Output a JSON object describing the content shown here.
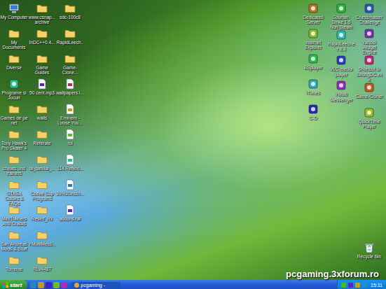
{
  "desktop": {
    "left_columns": [
      [
        {
          "label": "My Computer",
          "kind": "computer"
        },
        {
          "label": "My Documents",
          "kind": "folder"
        },
        {
          "label": "Diverse",
          "kind": "folder"
        },
        {
          "label": "Programe si Jocuri",
          "kind": "app"
        },
        {
          "label": "Games de pe net",
          "kind": "folder"
        },
        {
          "label": "Tony Hawk's Pro Skater 4",
          "kind": "folder"
        },
        {
          "label": "cheats und trainers",
          "kind": "folder"
        },
        {
          "label": "GTASA Guides & FAQs",
          "kind": "folder"
        },
        {
          "label": "MiniTrainers And Cracks",
          "kind": "folder"
        },
        {
          "label": "San Andreas Mods & Stuff",
          "kind": "folder"
        },
        {
          "label": "Torrente",
          "kind": "folder"
        }
      ],
      [
        {
          "label": "www.csnap... archive",
          "kind": "folder"
        },
        {
          "label": "InDC++0.4...",
          "kind": "folder"
        },
        {
          "label": "Game Guides",
          "kind": "folder"
        },
        {
          "label": "50 cent.mp3",
          "kind": "file"
        },
        {
          "label": "walls",
          "kind": "folder"
        },
        {
          "label": "Referate",
          "kind": "folder"
        },
        {
          "label": "la_familia_...",
          "kind": "folder"
        },
        {
          "label": "Coffee Cup Programs",
          "kind": "folder"
        },
        {
          "label": "Resetf_Rx",
          "kind": "folder"
        },
        {
          "label": "YMultiMess...",
          "kind": "folder"
        },
        {
          "label": "RLv4487",
          "kind": "folder"
        }
      ],
      [
        {
          "label": "sdc-100c8",
          "kind": "folder"
        },
        {
          "label": "RapidLeech...",
          "kind": "folder"
        },
        {
          "label": "Game-Clone...",
          "kind": "folder"
        },
        {
          "label": "wallpapers.l...",
          "kind": "file"
        },
        {
          "label": "Eminem - Loose You...",
          "kind": "file"
        },
        {
          "label": "rol",
          "kind": "file"
        },
        {
          "label": "114.Reflexi...",
          "kind": "file"
        },
        {
          "label": "29%20insth...",
          "kind": "file"
        },
        {
          "label": "addons.rar",
          "kind": "file"
        }
      ]
    ],
    "right_columns": [
      [
        {
          "label": "Dedicated Server",
          "kind": "app"
        },
        {
          "label": "Internet Explorer",
          "kind": "app"
        },
        {
          "label": "BSplayer",
          "kind": "app"
        },
        {
          "label": "iTunes",
          "kind": "app"
        },
        {
          "label": "C-D",
          "kind": "app"
        }
      ],
      [
        {
          "label": "Counter-Strike 1.6 Non Steam",
          "kind": "app"
        },
        {
          "label": "RapidLeecher 4.4",
          "kind": "app"
        },
        {
          "label": "VLC media player",
          "kind": "app"
        },
        {
          "label": "YMulti Messenger",
          "kind": "app"
        }
      ],
      [
        {
          "label": "Chessmaster Challenge",
          "kind": "app"
        },
        {
          "label": "Yahoo! Widget Engine",
          "kind": "app"
        },
        {
          "label": "Shortcut to StrongDC.exe",
          "kind": "app"
        },
        {
          "label": "Game-Cloner",
          "kind": "app"
        },
        {
          "label": "QuickTime Player",
          "kind": "app"
        }
      ]
    ],
    "recycle_bin": {
      "label": "Recycle Bin",
      "kind": "recycle"
    }
  },
  "taskbar": {
    "start": "start",
    "tasks": [
      {
        "label": "pcgaming -",
        "selected": true
      }
    ],
    "clock": "15:11"
  },
  "watermark": "pcgaming.3xforum.ro"
}
